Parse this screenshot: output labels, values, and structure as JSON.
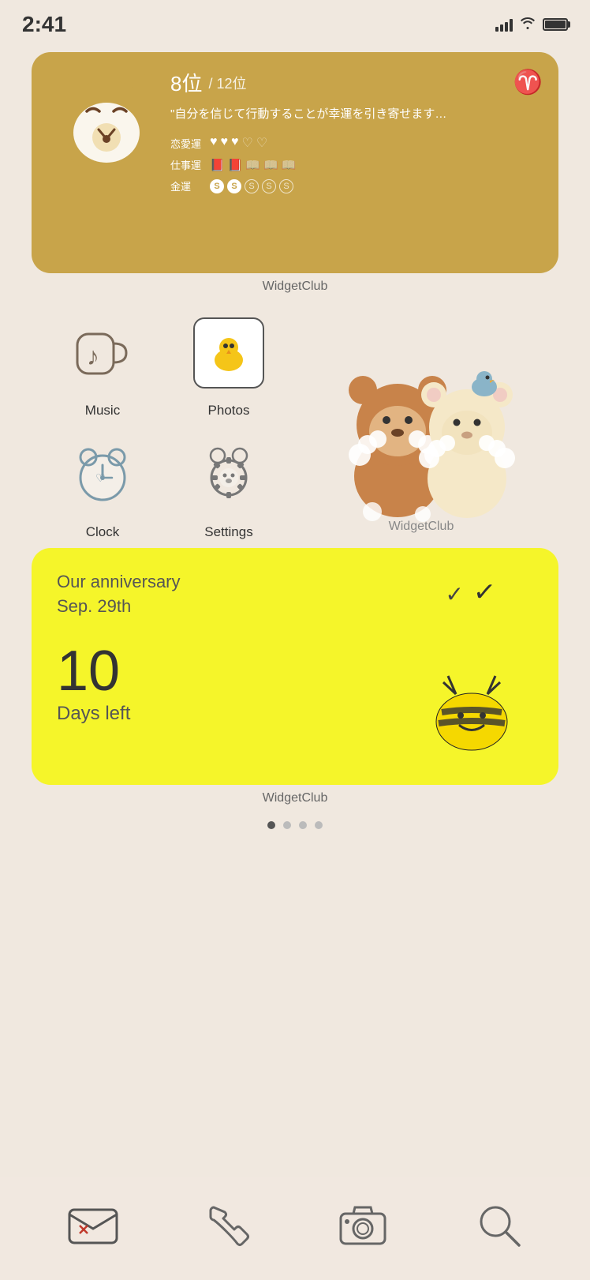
{
  "status": {
    "time": "2:41"
  },
  "fortune_widget": {
    "rank": "8位",
    "rank_suffix": "/ 12位",
    "sign": "♈",
    "quote": "\"自分を信じて行動することが幸運を引き寄せます…",
    "rows": [
      {
        "label": "恋愛運",
        "filled": 3,
        "empty": 2,
        "icon": "♥"
      },
      {
        "label": "仕事運",
        "filled": 2,
        "empty": 3,
        "icon": "📖"
      },
      {
        "label": "金運",
        "filled": 2,
        "empty": 3,
        "icon": "S"
      }
    ],
    "source": "WidgetClub"
  },
  "apps": [
    {
      "id": "music",
      "name": "Music"
    },
    {
      "id": "photos",
      "name": "Photos"
    },
    {
      "id": "clock",
      "name": "Clock"
    },
    {
      "id": "settings",
      "name": "Settings"
    },
    {
      "id": "widgetclub",
      "name": "WidgetClub"
    }
  ],
  "anniversary_widget": {
    "title_line1": "Our anniversary",
    "title_line2": "Sep. 29th",
    "number": "10",
    "unit": "Days left",
    "source": "WidgetClub"
  },
  "dock": {
    "items": [
      {
        "id": "mail",
        "label": "Mail"
      },
      {
        "id": "phone",
        "label": "Phone"
      },
      {
        "id": "camera",
        "label": "Camera"
      },
      {
        "id": "search",
        "label": "Search"
      }
    ]
  }
}
